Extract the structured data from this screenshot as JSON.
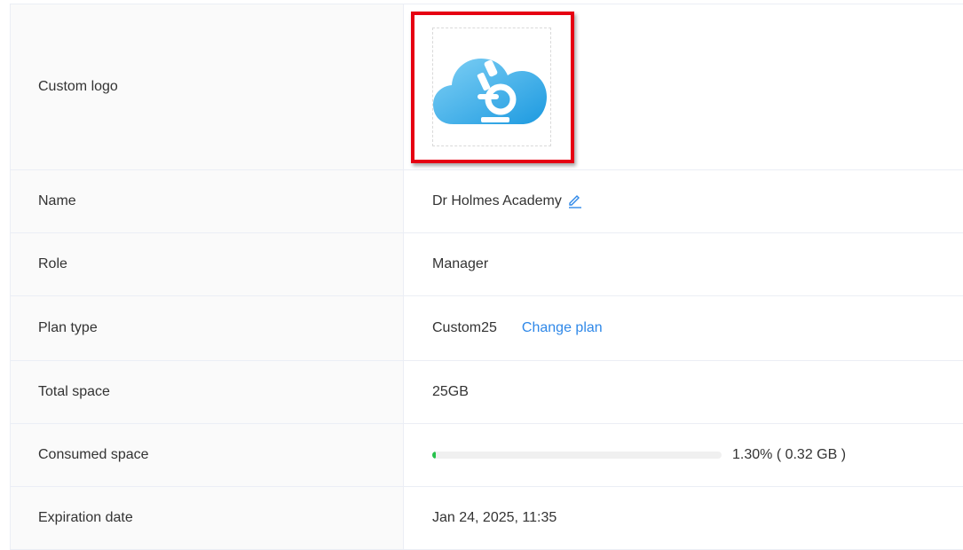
{
  "rows": {
    "logo": {
      "label": "Custom logo"
    },
    "name": {
      "label": "Name",
      "value": "Dr Holmes Academy"
    },
    "role": {
      "label": "Role",
      "value": "Manager"
    },
    "plan": {
      "label": "Plan type",
      "value": "Custom25",
      "link": "Change plan"
    },
    "total": {
      "label": "Total space",
      "value": "25GB"
    },
    "consumed": {
      "label": "Consumed space",
      "percent": 1.3,
      "text": "1.30% ( 0.32 GB )"
    },
    "expiration": {
      "label": "Expiration date",
      "value": "Jan 24, 2025, 11:35"
    }
  },
  "icons": {
    "logo": "cloud-microscope-icon",
    "edit": "pencil-icon"
  },
  "colors": {
    "link": "#2f88e8",
    "progress_fill": "#27c24c",
    "highlight": "#e60012",
    "logo_blue": "#3aa8e6"
  }
}
